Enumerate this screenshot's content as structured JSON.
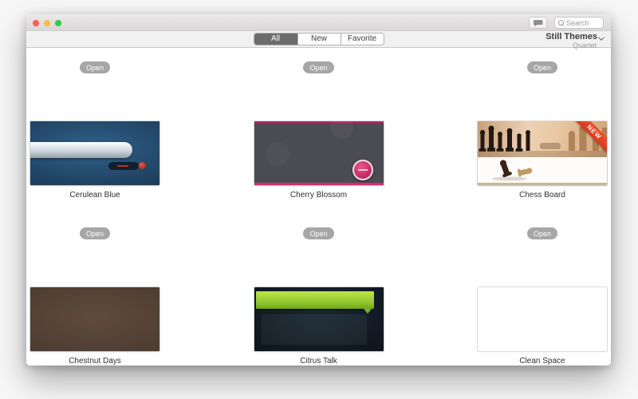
{
  "titlebar": {
    "traffic_lights": {
      "close_color": "#fc5b57",
      "minimize_color": "#fdbe41",
      "zoom_color": "#34c84a"
    },
    "feedback_button": {
      "icon": "speech-bubble-icon"
    },
    "search": {
      "placeholder": "Search",
      "icon": "magnifier-icon"
    }
  },
  "toolbar": {
    "segments": [
      {
        "label": "All",
        "selected": true
      },
      {
        "label": "New",
        "selected": false
      },
      {
        "label": "Favorite",
        "selected": false
      }
    ],
    "collection": {
      "name": "Still Themes",
      "variant": "Quartet",
      "icon": "chevron-down-icon"
    }
  },
  "content": {
    "open_button_label": "Open",
    "themes": [
      {
        "name": "Cerulean Blue",
        "accent": "#23486a"
      },
      {
        "name": "Cherry Blossom",
        "accent": "#d62b6d"
      },
      {
        "name": "Chess Board",
        "accent": "#e2472b",
        "badge": "NEW"
      },
      {
        "name": "Chestnut Days",
        "accent": "#4f3f32"
      },
      {
        "name": "Citrus Talk",
        "accent": "#a6d62f"
      },
      {
        "name": "Clean Space",
        "accent": "#ffffff"
      }
    ]
  }
}
